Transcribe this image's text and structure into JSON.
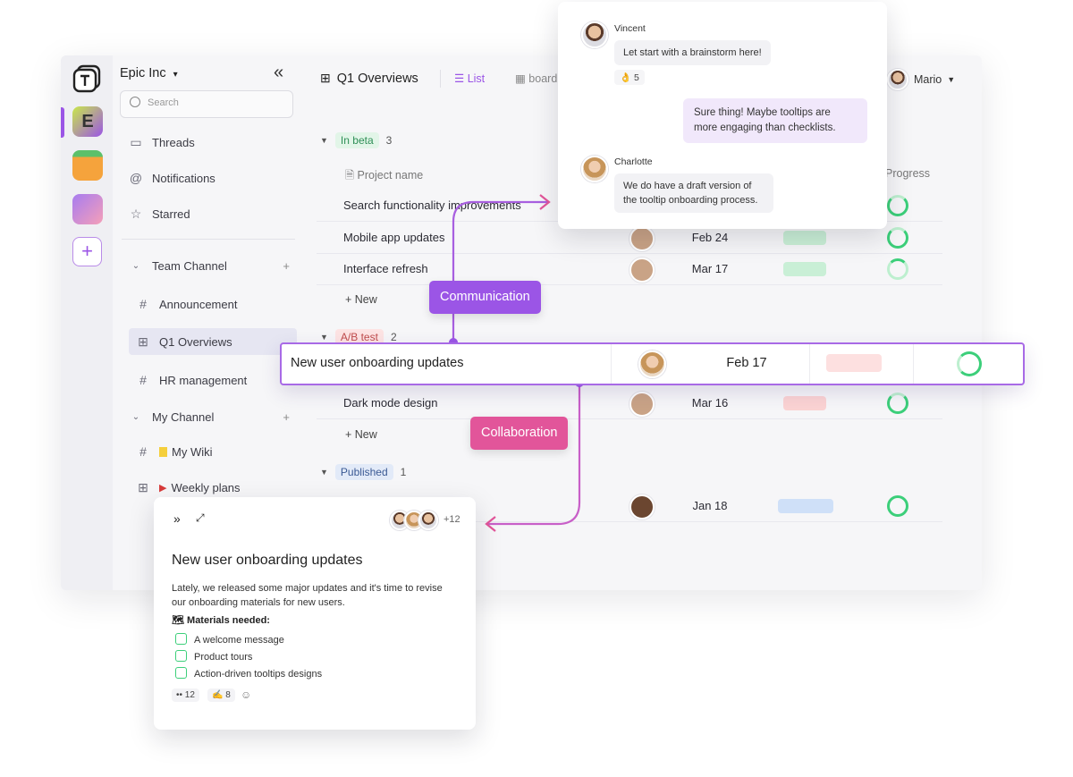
{
  "workspace": {
    "name": "Epic Inc",
    "caret": "▾",
    "collapse": "«",
    "initial": "E"
  },
  "search": {
    "placeholder": "Search"
  },
  "sidebar": {
    "top_items": [
      {
        "label": "Threads",
        "icon": "threads-icon"
      },
      {
        "label": "Notifications",
        "icon": "at-icon"
      },
      {
        "label": "Starred",
        "icon": "star-icon"
      }
    ],
    "team_channel": {
      "label": "Team Channel",
      "items": [
        {
          "label": "Announcement",
          "icon": "#"
        },
        {
          "label": "Q1 Overviews",
          "icon": "⊞"
        },
        {
          "label": "HR management",
          "icon": "#"
        }
      ]
    },
    "my_channel": {
      "label": "My Channel",
      "items": [
        {
          "label": "My Wiki",
          "icon": "#"
        },
        {
          "label": "Weekly plans",
          "icon": "⊞"
        }
      ]
    }
  },
  "header": {
    "title": "Q1 Overviews",
    "tabs": [
      "List",
      "board"
    ],
    "user": "Mario"
  },
  "table": {
    "column_name": "Project name",
    "column_progress": "Progress",
    "new_label": "New",
    "groups": [
      {
        "label": "In beta",
        "count": "3",
        "color": "#e2f5e8",
        "text_color": "#2f8f57"
      },
      {
        "label": "A/B test",
        "count": "2",
        "color": "#fde3e3",
        "text_color": "#c04c4c"
      },
      {
        "label": "Published",
        "count": "1",
        "color": "#e2eaf8",
        "text_color": "#3b5a94"
      }
    ],
    "rows": [
      {
        "name": "Search functionality improvements",
        "date": "",
        "bar_color": "#c9efd6"
      },
      {
        "name": "Mobile app updates",
        "date": "Feb 24",
        "bar_color": "#c9efd6"
      },
      {
        "name": "Interface refresh",
        "date": "Mar 17",
        "bar_color": "#c9efd6"
      },
      {
        "name": "Dark mode design",
        "date": "Mar 16",
        "bar_color": "#fbd3d3"
      },
      {
        "name": "",
        "date": "Jan 18",
        "bar_color": "#cfe0f8"
      }
    ],
    "highlight": {
      "name": "New user onboarding updates",
      "date": "Feb 17",
      "bar_color": "#fde0e0"
    }
  },
  "labels": {
    "communication": "Communication",
    "collaboration": "Collaboration"
  },
  "chat": {
    "messages": [
      {
        "author": "Vincent",
        "text": "Let start with a brainstorm here!",
        "reaction": "👌 5"
      },
      {
        "author": "",
        "text": "Sure thing! Maybe tooltips are more engaging than checklists."
      },
      {
        "author": "Charlotte",
        "text": "We do have a draft version of the tooltip onboarding process."
      }
    ]
  },
  "doc": {
    "expand": "»",
    "resize": "⤢",
    "more_count": "+12",
    "title": "New user onboarding updates",
    "body": "Lately, we released some major updates and it's time to revise our onboarding materials for new users.",
    "materials_heading": "Materials needed:",
    "materials_emoji": "🗺",
    "checklist": [
      "A welcome message",
      "Product tours",
      "Action-driven tooltips designs"
    ],
    "reactions": [
      "•• 12",
      "✍ 8"
    ]
  },
  "colors": {
    "accent_purple": "#9b55e6",
    "accent_pink": "#e2559a"
  }
}
